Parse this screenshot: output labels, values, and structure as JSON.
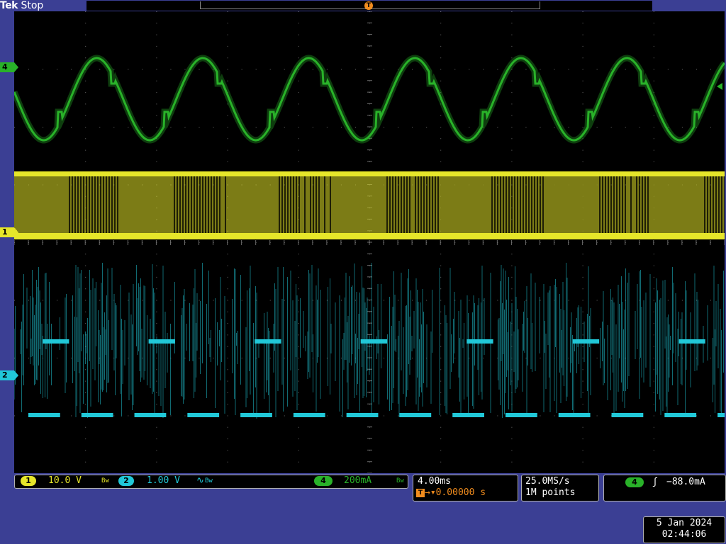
{
  "header": {
    "brand": "Tek",
    "run_state": "Stop"
  },
  "markers": {
    "trigger_top": "T",
    "trigger_pos": "T",
    "ch4": "4",
    "ch1": "1",
    "ch2": "2"
  },
  "vertical": {
    "ch1": {
      "badge": "1",
      "scale": "10.0 V",
      "bw_label": "Bw"
    },
    "ch2": {
      "badge": "2",
      "scale": "1.00 V",
      "coupling_symbol": "∿",
      "bw_label": "Bw"
    },
    "ch4": {
      "badge": "4",
      "scale": "200mA",
      "bw_label": "Bw"
    }
  },
  "horizontal": {
    "scale": "4.00ms",
    "trigger_icon": "T",
    "delay": "→▾0.00000 s"
  },
  "acquisition": {
    "sample_rate": "25.0MS/s",
    "record_length": "1M points"
  },
  "trigger": {
    "source_badge": "4",
    "slope_symbol": "ʃ",
    "level": "−88.0mA"
  },
  "datetime": {
    "date": "5 Jan  2024",
    "time": "02:44:06"
  },
  "colors": {
    "background": "#3b3f94",
    "ch1": "#e6e62a",
    "ch2": "#21c8d8",
    "ch4": "#29b229",
    "trigger": "#f08c1e",
    "grid": "#6b6b6b"
  },
  "waveforms": {
    "ch4": {
      "shape": "sine",
      "cycles_visible": 6.7
    },
    "ch1": {
      "shape": "pwm-square"
    },
    "ch2": {
      "shape": "switching-pulse"
    }
  }
}
